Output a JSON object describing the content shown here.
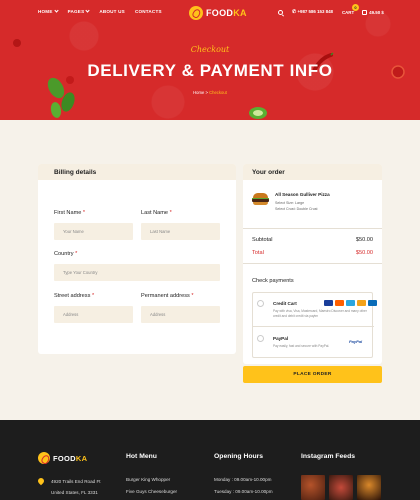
{
  "header": {
    "nav": [
      {
        "label": "HOME",
        "dropdown": true
      },
      {
        "label": "PAGES",
        "dropdown": true
      },
      {
        "label": "ABOUT US",
        "dropdown": false
      },
      {
        "label": "CONTACTS",
        "dropdown": false
      }
    ],
    "brand_primary": "FOOD",
    "brand_accent": "KA",
    "phone": "+987 586 153 848",
    "cart_label": "CART",
    "cart_count": "0",
    "cart_total": "49.50 $"
  },
  "hero": {
    "subtitle": "Checkout",
    "title": "DELIVERY & PAYMENT INFO",
    "breadcrumb_home": "Home",
    "breadcrumb_sep": ">",
    "breadcrumb_current": "Checkout"
  },
  "billing": {
    "title": "Billing details",
    "first_name": {
      "label": "First Name",
      "placeholder": "Your Name"
    },
    "last_name": {
      "label": "Last Name",
      "placeholder": "Last Name"
    },
    "country": {
      "label": "Country",
      "placeholder": "Type Your Country"
    },
    "street": {
      "label": "Street address",
      "placeholder": "Address"
    },
    "permanent": {
      "label": "Permanent address",
      "placeholder": "Address"
    },
    "required_mark": "*"
  },
  "order": {
    "title": "Your order",
    "item_name": "All Season Gulliver Pizza",
    "item_size": "Select Size: Large",
    "item_crust": "Select Crust: Double Crust",
    "subtotal_label": "Subtotal",
    "subtotal_value": "$50.00",
    "total_label": "Total",
    "total_value": "$50.00",
    "payments_title": "Check payments",
    "credit_card_name": "Credit Cart",
    "credit_card_desc": "Pay with visa, Visa, Mastercard, Maestro Discover and many other credit and debit credit via paytm",
    "paypal_name": "PayPal",
    "paypal_desc": "Pay easily, fast and secure with PayPal.",
    "paypal_logo": "PayPal",
    "place_order": "PLACE ORDER",
    "card_colors": [
      "#1a3e9a",
      "#ff5f00",
      "#2aa6e0",
      "#f3a21a",
      "#0a6cb8"
    ]
  },
  "footer": {
    "brand_primary": "FOOD",
    "brand_accent": "KA",
    "address_line1": "4920 Trails End Road Ft",
    "address_line2": "United States, FL 3331",
    "menu_title": "Hot Menu",
    "menu_items": [
      "Burger King Whopper",
      "Five Guys Cheeseburger"
    ],
    "hours_title": "Opening Hours",
    "hours": [
      "Monday : 09.00am-10.00pm",
      "Tuesday : 09.00am-10.00pm"
    ],
    "instagram_title": "Instagram Feeds"
  },
  "colors": {
    "primary": "#d62a2a",
    "accent": "#ffc21a",
    "dark": "#1d1d1d",
    "cream": "#f6f2ea"
  }
}
